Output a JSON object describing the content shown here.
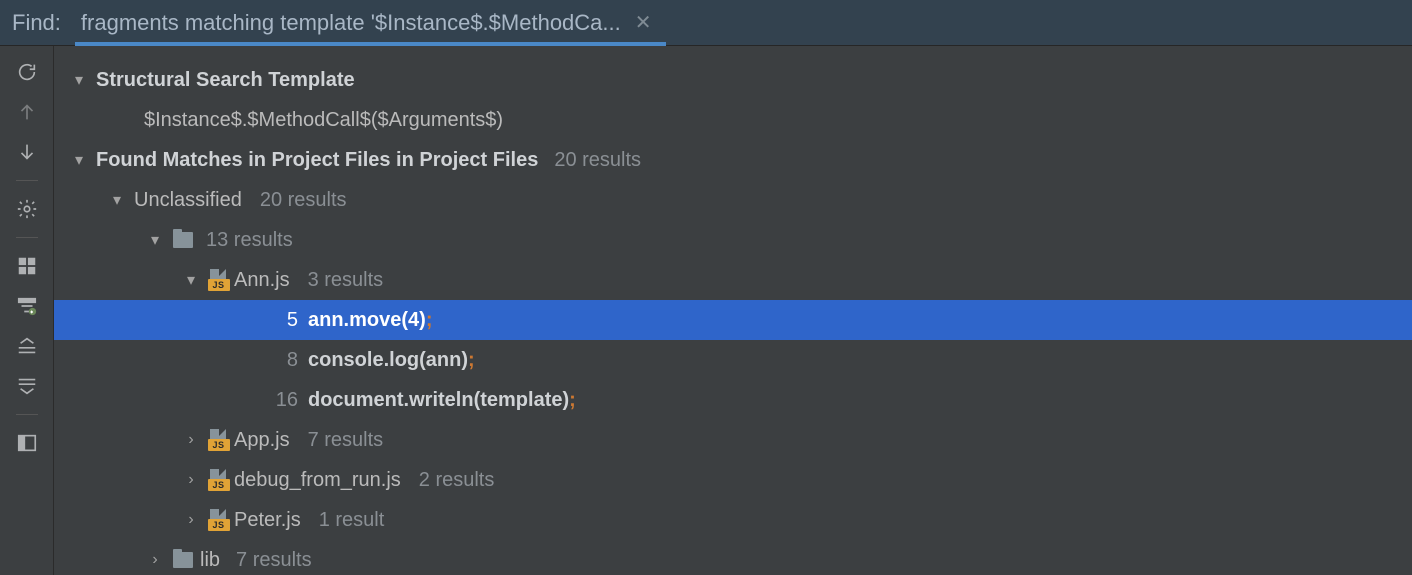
{
  "header": {
    "find_label": "Find:",
    "tab_title": "fragments matching template '$Instance$.$MethodCa..."
  },
  "tree": {
    "template_header": "Structural Search Template",
    "template_body": "$Instance$.$MethodCall$($Arguments$)",
    "matches_header": "Found Matches in Project Files in Project Files",
    "matches_count": "20 results",
    "unclassified": {
      "label": "Unclassified",
      "count": "20 results"
    },
    "root_folder": {
      "count": "13 results"
    },
    "files": [
      {
        "name": "Ann.js",
        "count": "3 results",
        "expanded": true,
        "lines": [
          {
            "n": "5",
            "pre": "ann.move(4)",
            "tail": ";",
            "selected": true
          },
          {
            "n": "8",
            "pre": "console.log(ann)",
            "tail": ";"
          },
          {
            "n": "16",
            "pre": "document.writeln(template)",
            "tail": ";"
          }
        ]
      },
      {
        "name": "App.js",
        "count": "7 results"
      },
      {
        "name": "debug_from_run.js",
        "count": "2 results"
      },
      {
        "name": "Peter.js",
        "count": "1 result"
      }
    ],
    "lib_folder": {
      "name": "lib",
      "count": "7 results"
    }
  }
}
